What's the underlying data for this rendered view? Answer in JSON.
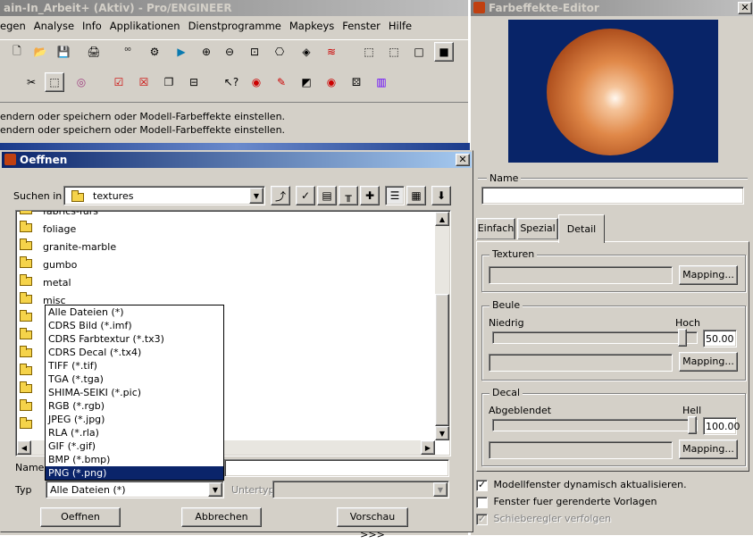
{
  "main_window": {
    "title": "ain-In_Arbeit+ (Aktiv) - Pro/ENGINEER",
    "menu": [
      "egen",
      "Analyse",
      "Info",
      "Applikationen",
      "Dienstprogramme",
      "Mapkeys",
      "Fenster",
      "Hilfe"
    ],
    "messages": [
      "endern oder speichern oder Modell-Farbeffekte einstellen.",
      "endern oder speichern oder Modell-Farbeffekte einstellen."
    ]
  },
  "editor": {
    "title": "Farbeffekte-Editor",
    "close": "✕",
    "name_label": "Name",
    "name_value": "",
    "tabs": [
      "Einfach",
      "Spezial",
      "Detail"
    ],
    "active_tab": "Detail",
    "texturen": {
      "label": "Texturen",
      "mapping": "Mapping..."
    },
    "beule": {
      "label": "Beule",
      "low": "Niedrig",
      "high": "Hoch",
      "value": "50.00",
      "level": 0.95,
      "mapping": "Mapping..."
    },
    "decal": {
      "label": "Decal",
      "low": "Abgeblendet",
      "high": "Hell",
      "value": "100.00",
      "level": 1.0,
      "mapping": "Mapping..."
    },
    "options": [
      {
        "label": "Modellfenster dynamisch aktualisieren.",
        "checked": true,
        "enabled": true
      },
      {
        "label": "Fenster fuer gerenderte Vorlagen",
        "checked": false,
        "enabled": true
      },
      {
        "label": "Schieberegler verfolgen",
        "checked": true,
        "enabled": false
      }
    ],
    "colors": {
      "preview_bg": "#082468",
      "sphere": "#d07838"
    }
  },
  "open_dialog": {
    "title": "Oeffnen",
    "close": "✕",
    "look_in_label": "Suchen in",
    "look_in_value": "textures",
    "folders": [
      "fabrics-furs",
      "foliage",
      "granite-marble",
      "gumbo",
      "metal",
      "misc",
      "",
      "",
      "",
      "",
      "",
      "",
      ""
    ],
    "filetype_options": [
      "Alle Dateien (*)",
      "CDRS Bild (*.imf)",
      "CDRS Farbtextur (*.tx3)",
      "CDRS Decal (*.tx4)",
      "TIFF (*.tif)",
      "TGA (*.tga)",
      "SHIMA-SEIKI (*.pic)",
      "RGB (*.rgb)",
      "JPEG (*.jpg)",
      "RLA (*.rla)",
      "GIF (*.gif)",
      "BMP (*.bmp)",
      "PNG (*.png)"
    ],
    "highlighted_option": "PNG (*.png)",
    "name_label": "Name",
    "type_label": "Typ",
    "type_value": "Alle Dateien (*)",
    "subtype_label": "Untertyp",
    "buttons": {
      "open": "Oeffnen",
      "cancel": "Abbrechen",
      "preview": "Vorschau >>>"
    }
  }
}
